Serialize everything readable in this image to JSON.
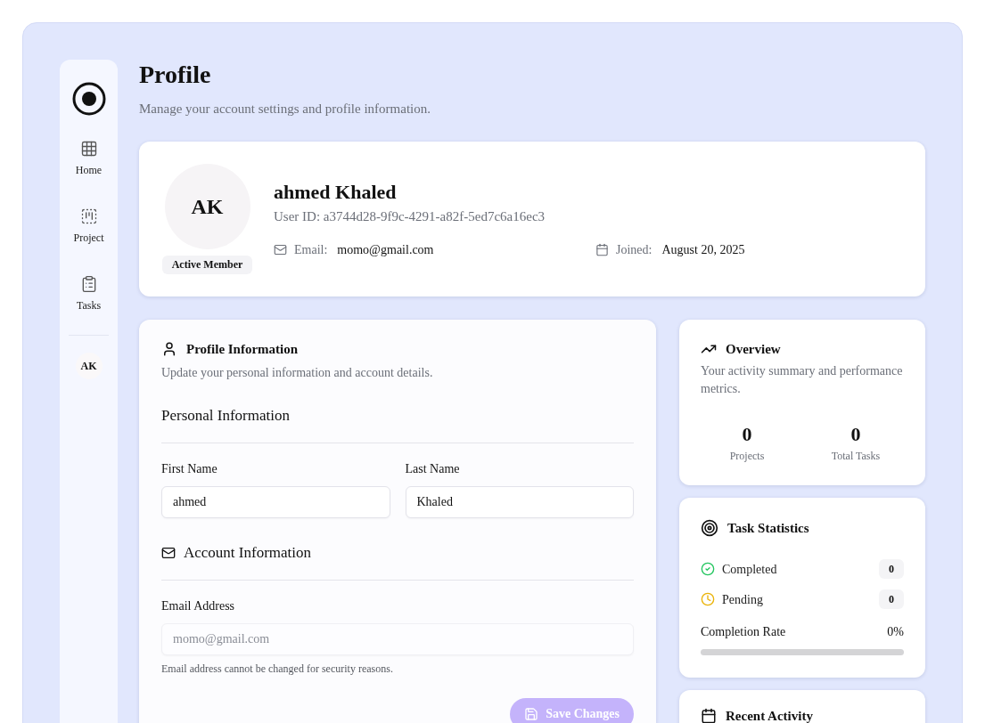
{
  "sidebar": {
    "items": [
      {
        "label": "Home",
        "selected": false
      },
      {
        "label": "Project",
        "selected": false
      },
      {
        "label": "Tasks",
        "selected": false
      }
    ],
    "user_initials": "AK"
  },
  "header": {
    "title": "Profile",
    "subtitle": "Manage your account settings and profile information."
  },
  "profile_card": {
    "initials": "AK",
    "status": "Active Member",
    "name": "ahmed Khaled",
    "user_id": "User ID: a3744d28-9f9c-4291-a82f-5ed7c6a16ec3",
    "details": [
      {
        "kind": "email",
        "label": "Email:",
        "value": "momo@gmail.com"
      },
      {
        "kind": "joined",
        "label": "Joined:",
        "value": "August 20, 2025"
      }
    ]
  },
  "profile_form": {
    "title": "Profile Information",
    "subtitle": "Update your personal information and account details.",
    "sections": [
      {
        "kind": "personal",
        "title": "Personal Information",
        "fields": [
          {
            "label": "First Name",
            "value": "ahmed",
            "disabled": false
          },
          {
            "label": "Last Name",
            "value": "Khaled",
            "disabled": false
          }
        ]
      },
      {
        "kind": "account",
        "title": "Account Information",
        "fields": [
          {
            "label": "Email Address",
            "value": "momo@gmail.com",
            "disabled": true,
            "hint": "Email address cannot be changed for security reasons."
          }
        ]
      }
    ],
    "save_button": {
      "label": "Save Changes",
      "disabled": true
    }
  },
  "overview": {
    "title": "Overview",
    "subtitle": "Your activity summary and performance metrics.",
    "stats": [
      {
        "value": "0",
        "label": "Projects"
      },
      {
        "value": "0",
        "label": "Total Tasks"
      }
    ]
  },
  "task_statistics": {
    "title": "Task Statistics",
    "rows": [
      {
        "kind": "completed",
        "label": "Completed",
        "count": "0"
      },
      {
        "kind": "pending",
        "label": "Pending",
        "count": "0"
      }
    ],
    "completion": {
      "label": "Completion Rate",
      "reading": "0%"
    }
  },
  "recent_activity": {
    "title": "Recent Activity"
  }
}
